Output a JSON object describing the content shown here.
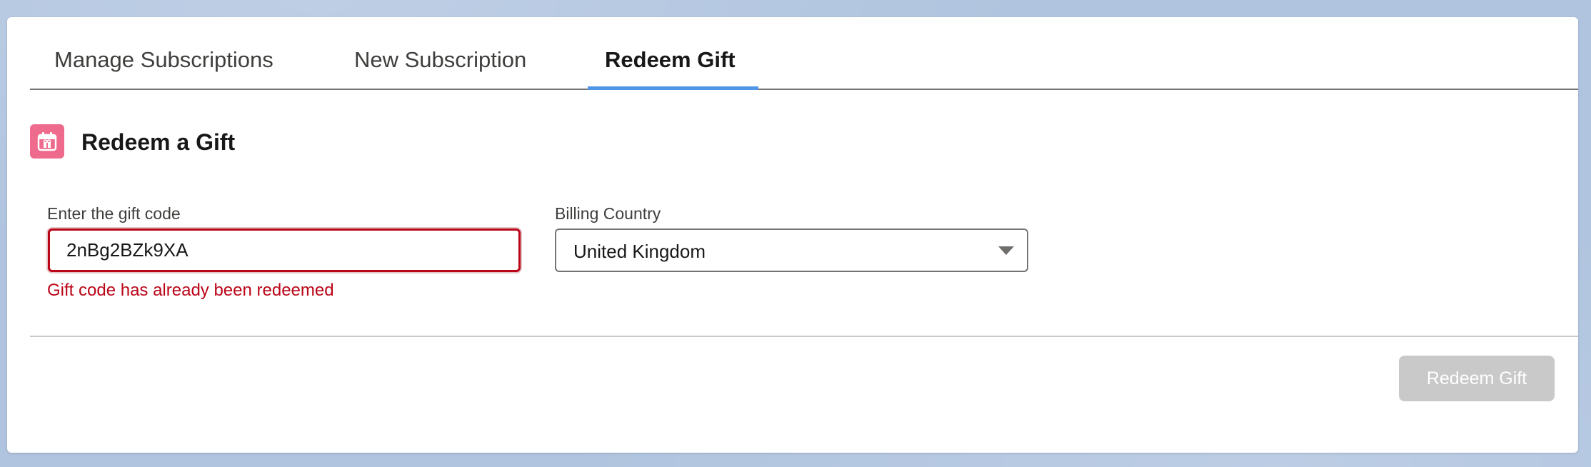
{
  "tabs": [
    {
      "label": "Manage Subscriptions",
      "active": false
    },
    {
      "label": "New Subscription",
      "active": false
    },
    {
      "label": "Redeem Gift",
      "active": true
    }
  ],
  "section": {
    "title": "Redeem a Gift",
    "icon": "gift-calendar-icon",
    "icon_color": "#ef6b8d"
  },
  "form": {
    "gift_code": {
      "label": "Enter the gift code",
      "value": "2nBg2BZk9XA",
      "error": "Gift code has already been redeemed"
    },
    "billing_country": {
      "label": "Billing Country",
      "selected": "United Kingdom"
    }
  },
  "actions": {
    "redeem_label": "Redeem Gift",
    "redeem_disabled": true
  },
  "colors": {
    "active_tab_underline": "#4f96e8",
    "error": "#ba0517",
    "disabled_button": "#c9c9c9",
    "background": "#b0c4df"
  }
}
